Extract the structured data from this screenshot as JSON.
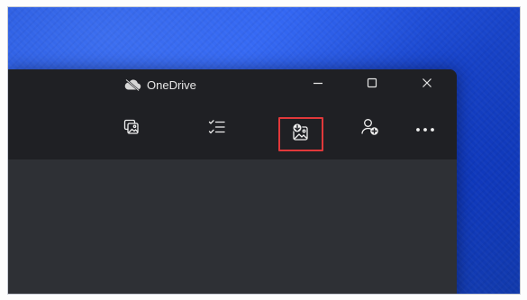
{
  "window": {
    "title": "OneDrive"
  },
  "window_controls": {
    "minimize_icon": "minimize-icon",
    "maximize_icon": "maximize-icon",
    "close_icon": "close-icon"
  },
  "toolbar": {
    "buttons": [
      {
        "name": "photos-button",
        "icon": "photo-gallery-icon"
      },
      {
        "name": "checklist-button",
        "icon": "checklist-icon"
      },
      {
        "name": "photo-backup-button",
        "icon": "photo-upload-icon",
        "highlighted": true
      },
      {
        "name": "add-account-button",
        "icon": "person-add-icon"
      },
      {
        "name": "more-options-button",
        "icon": "more-horizontal-icon"
      }
    ]
  },
  "colors": {
    "wallpaper": "#2352e0",
    "titlebar": "#1f2024",
    "content": "#2e3035",
    "highlight_border": "#e0383a",
    "text": "#e8e8e8"
  }
}
